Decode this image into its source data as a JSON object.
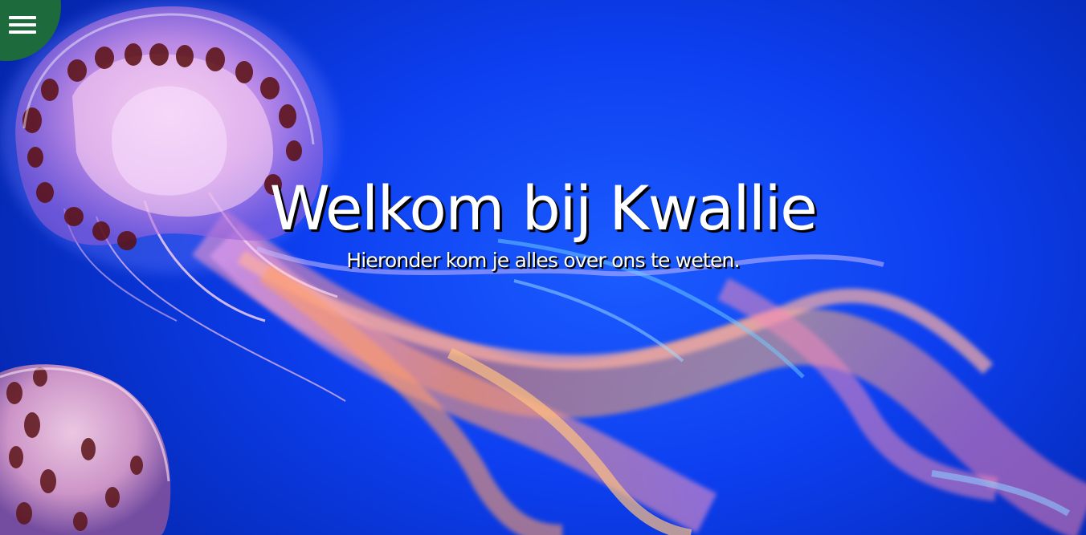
{
  "menu": {
    "icon": "hamburger-menu-icon",
    "color": "#1d6a3c"
  },
  "hero": {
    "title": "Welkom bij Kwallie",
    "subtitle": "Hieronder kom je alles over ons te weten.",
    "background_color": "#0d3ff0"
  }
}
